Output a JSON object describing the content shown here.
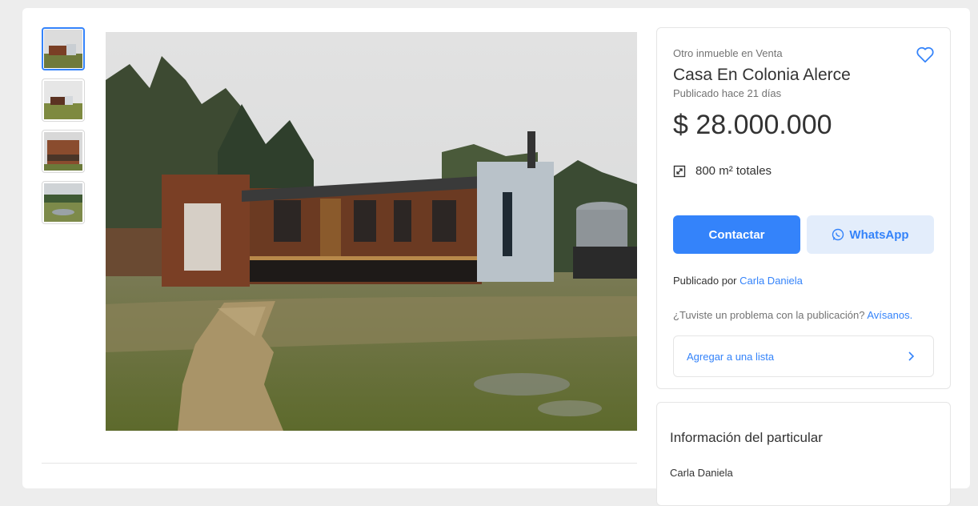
{
  "listing": {
    "category": "Otro inmueble en Venta",
    "title": "Casa En Colonia Alerce",
    "published": "Publicado hace 21 días",
    "price": "$ 28.000.000",
    "area": "800 m² totales"
  },
  "actions": {
    "contact_label": "Contactar",
    "whatsapp_label": "WhatsApp",
    "add_to_list_label": "Agregar a una lista"
  },
  "seller": {
    "published_by_label": "Publicado por",
    "name": "Carla Daniela"
  },
  "report": {
    "question": "¿Tuviste un problema con la publicación?",
    "link": "Avísanos."
  },
  "particular": {
    "heading": "Información del particular",
    "name": "Carla Daniela"
  },
  "gallery": {
    "thumbnail_count": 4,
    "selected_index": 0
  },
  "colors": {
    "accent": "#3483fa",
    "accent_light": "#e3edfb",
    "background": "#ededed"
  },
  "icons": [
    "heart-icon",
    "area-icon",
    "whatsapp-icon",
    "chevron-right-icon"
  ]
}
